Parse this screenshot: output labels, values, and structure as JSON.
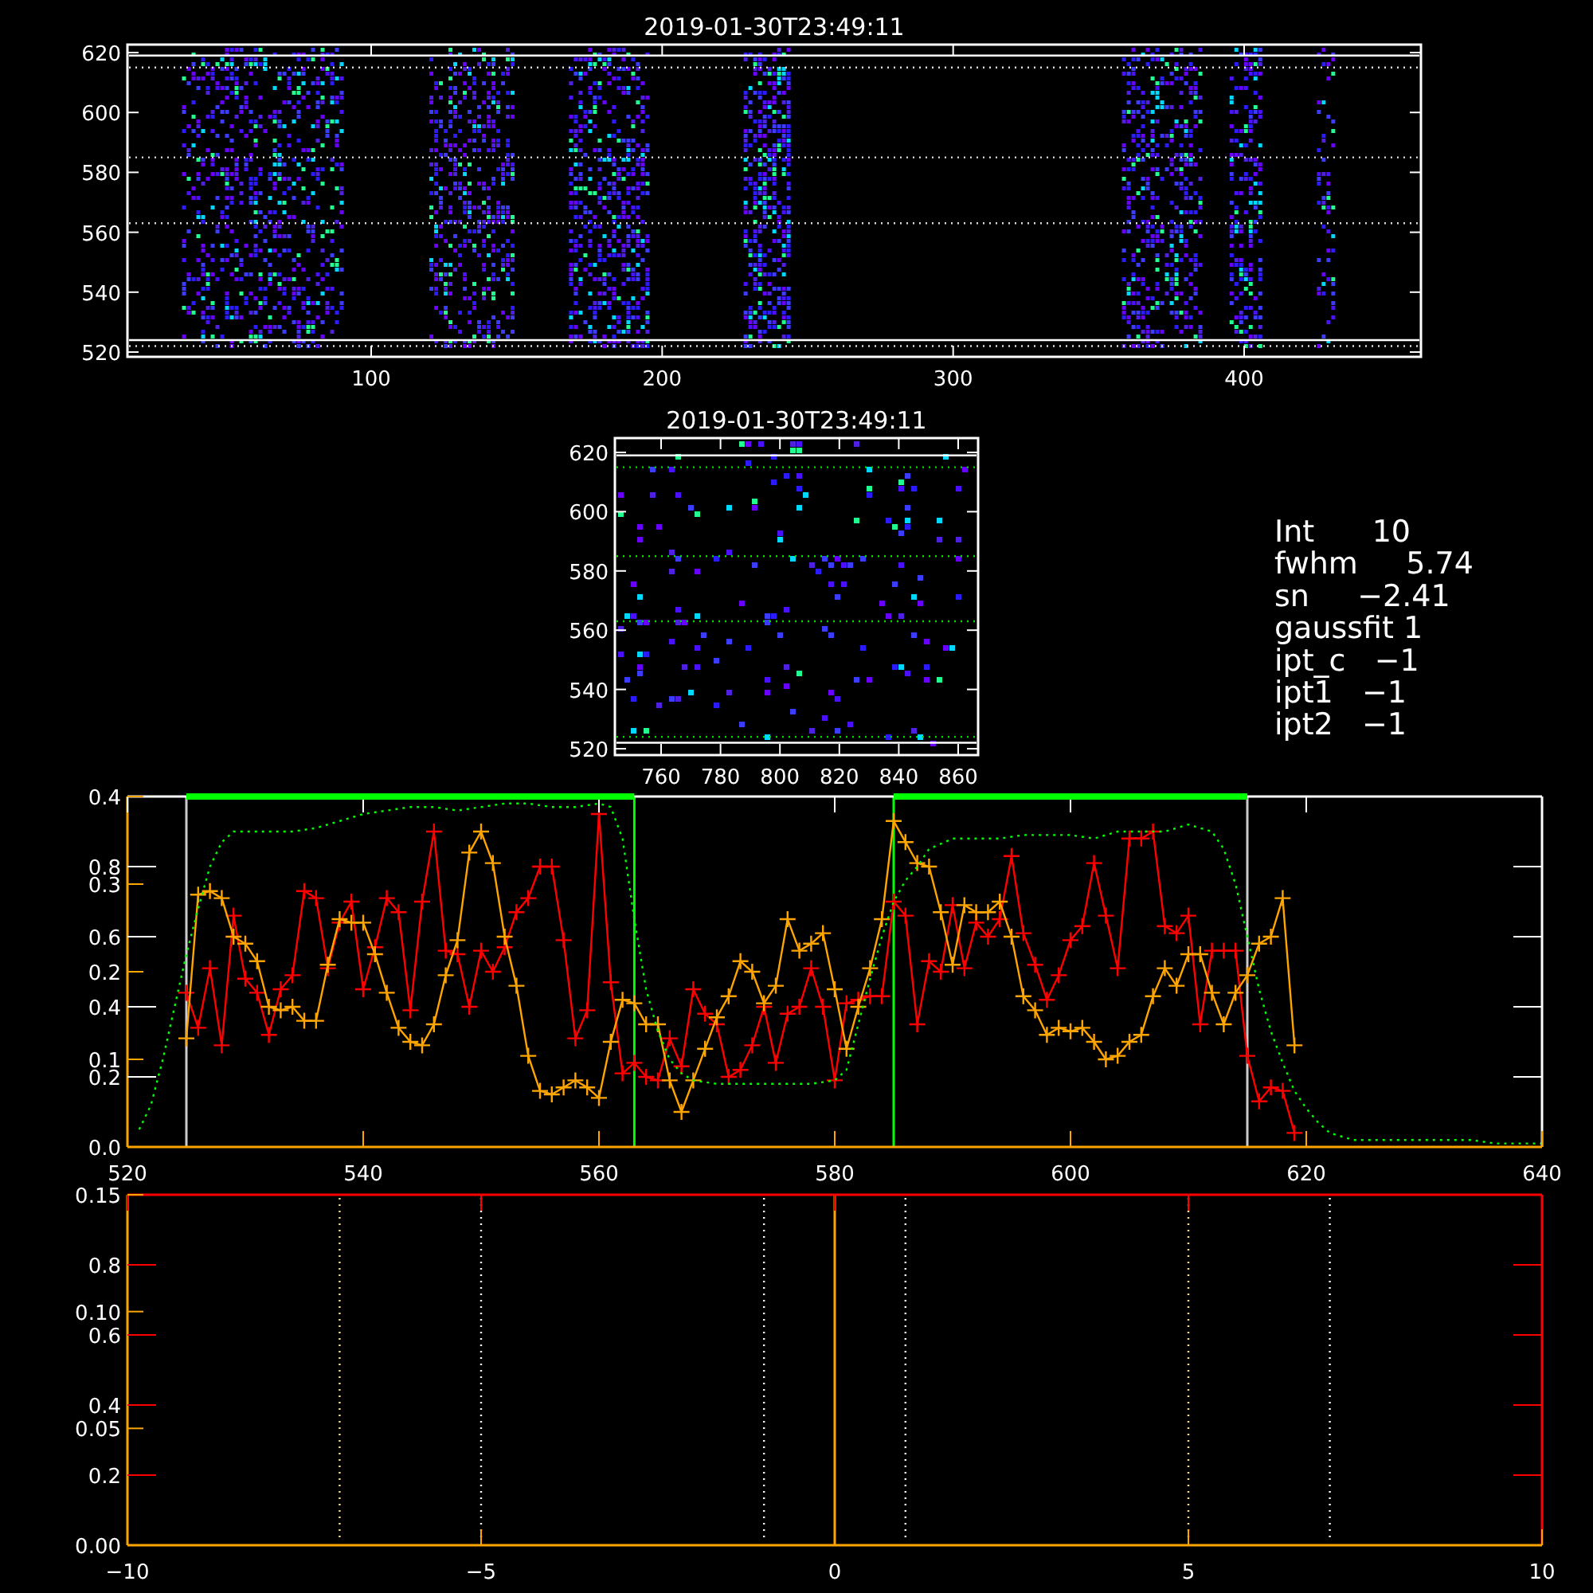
{
  "top_image": {
    "title": "2019-01-30T23:49:11",
    "x_tick_labels": [
      "100",
      "200",
      "300",
      "400"
    ],
    "y_tick_labels": [
      "620",
      "600",
      "580",
      "560",
      "540",
      "520"
    ]
  },
  "zoom_image": {
    "title": "2019-01-30T23:49:11",
    "x_tick_labels": [
      "760",
      "780",
      "800",
      "820",
      "840",
      "860"
    ],
    "y_tick_labels": [
      "620",
      "600",
      "580",
      "560",
      "540",
      "520"
    ]
  },
  "fit_stats": [
    {
      "text": "Int      10"
    },
    {
      "text": "fwhm     5.74"
    },
    {
      "text": "sn     −2.41"
    },
    {
      "text": "gaussfit 1"
    },
    {
      "text": "ipt_c   −1"
    },
    {
      "text": "ipt1   −1"
    },
    {
      "text": "ipt2   −1"
    }
  ],
  "profile_plot": {
    "secondary_axis_labels": [
      "0.4",
      "0.3",
      "0.2",
      "0.1",
      "0.0"
    ],
    "chart_data": {
      "type": "line",
      "xlim": [
        520,
        640
      ],
      "ylim": [
        0,
        1
      ],
      "x": [
        525,
        526,
        527,
        528,
        529,
        530,
        531,
        532,
        533,
        534,
        535,
        536,
        537,
        538,
        539,
        540,
        541,
        542,
        543,
        544,
        545,
        546,
        547,
        548,
        549,
        550,
        551,
        552,
        553,
        554,
        555,
        556,
        557,
        558,
        559,
        560,
        561,
        562,
        563,
        564,
        565,
        566,
        567,
        568,
        569,
        570,
        571,
        572,
        573,
        574,
        575,
        576,
        577,
        578,
        579,
        580,
        581,
        582,
        583,
        584,
        585,
        586,
        587,
        588,
        589,
        590,
        591,
        592,
        593,
        594,
        595,
        596,
        597,
        598,
        599,
        600,
        601,
        602,
        603,
        604,
        605,
        606,
        607,
        608,
        609,
        610,
        611,
        612,
        613,
        614,
        615,
        616,
        617,
        618,
        619
      ],
      "xticks": [
        520,
        540,
        560,
        580,
        600,
        620,
        640
      ],
      "yticks": [
        0.2,
        0.4,
        0.6,
        0.8
      ],
      "series": [
        {
          "color": "#ff0000",
          "marker": "+",
          "values": [
            0.44,
            0.34,
            0.51,
            0.29,
            0.66,
            0.48,
            0.44,
            0.32,
            0.45,
            0.49,
            0.73,
            0.71,
            0.51,
            0.64,
            0.7,
            0.45,
            0.57,
            0.71,
            0.67,
            0.39,
            0.7,
            0.9,
            0.56,
            0.55,
            0.4,
            0.56,
            0.5,
            0.57,
            0.67,
            0.71,
            0.8,
            0.8,
            0.59,
            0.31,
            0.39,
            0.95,
            0.47,
            0.21,
            0.24,
            0.2,
            0.19,
            0.31,
            0.23,
            0.45,
            0.38,
            0.35,
            0.2,
            0.22,
            0.29,
            0.4,
            0.24,
            0.38,
            0.4,
            0.51,
            0.4,
            0.19,
            0.41,
            0.42,
            0.43,
            0.43,
            0.7,
            0.66,
            0.35,
            0.53,
            0.5,
            0.69,
            0.51,
            0.64,
            0.6,
            0.65,
            0.83,
            0.61,
            0.52,
            0.42,
            0.49,
            0.59,
            0.63,
            0.81,
            0.66,
            0.51,
            0.88,
            0.88,
            0.9,
            0.63,
            0.61,
            0.66,
            0.35,
            0.56,
            0.56,
            0.56,
            0.26,
            0.13,
            0.17,
            0.16,
            0.04
          ]
        },
        {
          "color": "#ffa500",
          "marker": "+",
          "values": [
            0.31,
            0.72,
            0.73,
            0.71,
            0.6,
            0.58,
            0.53,
            0.4,
            0.39,
            0.4,
            0.36,
            0.36,
            0.52,
            0.65,
            0.64,
            0.64,
            0.55,
            0.44,
            0.34,
            0.3,
            0.29,
            0.35,
            0.49,
            0.59,
            0.84,
            0.9,
            0.81,
            0.6,
            0.46,
            0.26,
            0.16,
            0.15,
            0.17,
            0.19,
            0.17,
            0.14,
            0.3,
            0.42,
            0.41,
            0.35,
            0.35,
            0.19,
            0.1,
            0.19,
            0.28,
            0.37,
            0.43,
            0.53,
            0.5,
            0.41,
            0.46,
            0.65,
            0.56,
            0.58,
            0.61,
            0.45,
            0.28,
            0.4,
            0.51,
            0.65,
            0.93,
            0.87,
            0.81,
            0.8,
            0.67,
            0.52,
            0.69,
            0.67,
            0.67,
            0.7,
            0.6,
            0.43,
            0.39,
            0.32,
            0.34,
            0.33,
            0.34,
            0.3,
            0.25,
            0.26,
            0.3,
            0.32,
            0.43,
            0.51,
            0.46,
            0.55,
            0.55,
            0.44,
            0.35,
            0.44,
            0.49,
            0.58,
            0.6,
            0.71,
            0.29
          ]
        },
        {
          "color": "#00ff00",
          "line_style": "dotted",
          "x": [
            521,
            522,
            523,
            524,
            525,
            526,
            527,
            528,
            529,
            530,
            532,
            534,
            536,
            538,
            540,
            542,
            544,
            546,
            548,
            550,
            552,
            554,
            556,
            558,
            560,
            561,
            562,
            563,
            564,
            565,
            566,
            567,
            568,
            570,
            572,
            574,
            576,
            578,
            580,
            581,
            582,
            583,
            584,
            585,
            586,
            587,
            588,
            590,
            592,
            594,
            596,
            598,
            600,
            602,
            604,
            606,
            608,
            610,
            612,
            613,
            614,
            615,
            616,
            617,
            618,
            619,
            620,
            621,
            622,
            624,
            626,
            630,
            634,
            636,
            640
          ],
          "values": [
            0.05,
            0.12,
            0.25,
            0.4,
            0.55,
            0.68,
            0.8,
            0.87,
            0.9,
            0.9,
            0.9,
            0.9,
            0.91,
            0.93,
            0.95,
            0.96,
            0.97,
            0.97,
            0.96,
            0.97,
            0.98,
            0.98,
            0.97,
            0.97,
            0.98,
            0.97,
            0.88,
            0.65,
            0.45,
            0.33,
            0.25,
            0.21,
            0.19,
            0.18,
            0.18,
            0.18,
            0.18,
            0.18,
            0.19,
            0.22,
            0.35,
            0.48,
            0.6,
            0.7,
            0.76,
            0.8,
            0.85,
            0.88,
            0.88,
            0.88,
            0.89,
            0.89,
            0.89,
            0.88,
            0.9,
            0.9,
            0.9,
            0.92,
            0.9,
            0.85,
            0.75,
            0.6,
            0.45,
            0.33,
            0.24,
            0.16,
            0.11,
            0.07,
            0.04,
            0.02,
            0.02,
            0.02,
            0.02,
            0.01,
            0.01
          ]
        }
      ],
      "ref_lines": [
        {
          "axis": "x",
          "value": 525,
          "color": "#cccccc"
        },
        {
          "axis": "x",
          "value": 563,
          "color": "#00ff00"
        },
        {
          "axis": "x",
          "value": 585,
          "color": "#00ff00"
        },
        {
          "axis": "x",
          "value": 615,
          "color": "#cccccc"
        }
      ]
    }
  },
  "offset_plot": {
    "secondary_axis_labels": [
      "0.15",
      "0.10",
      "0.05",
      "0.00"
    ],
    "chart_data": {
      "type": "line",
      "xlim": [
        -10,
        10
      ],
      "ylim": [
        0,
        1
      ],
      "xticks": [
        {
          "value": -10,
          "label": "−10"
        },
        {
          "value": -5,
          "label": "−5"
        },
        {
          "value": 0,
          "label": "0"
        },
        {
          "value": 5,
          "label": "5"
        },
        {
          "value": 10,
          "label": "10"
        }
      ],
      "yticks": [
        0.2,
        0.4,
        0.6,
        0.8
      ],
      "ref_lines": [
        {
          "axis": "x",
          "value": -7,
          "color": "#ffdd88",
          "line_style": "dotted"
        },
        {
          "axis": "x",
          "value": -5,
          "color": "#ffffff",
          "line_style": "dotted"
        },
        {
          "axis": "x",
          "value": -1,
          "color": "#ffffff",
          "line_style": "dotted"
        },
        {
          "axis": "x",
          "value": 0,
          "color": "#ffa500"
        },
        {
          "axis": "x",
          "value": 1,
          "color": "#ffffff",
          "line_style": "dotted"
        },
        {
          "axis": "x",
          "value": 5,
          "color": "#ffdd88",
          "line_style": "dotted"
        },
        {
          "axis": "x",
          "value": 7,
          "color": "#ffffff",
          "line_style": "dotted"
        }
      ]
    }
  }
}
